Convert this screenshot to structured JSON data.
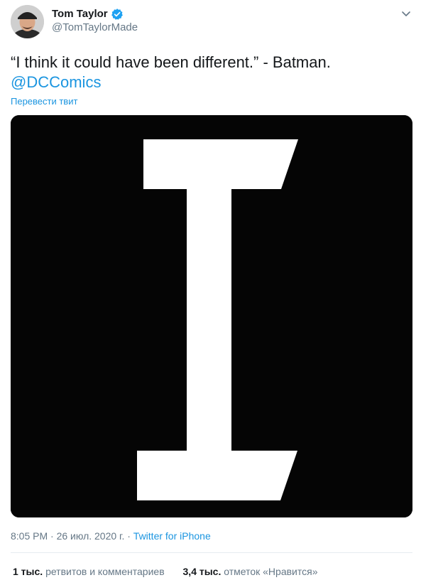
{
  "author": {
    "name": "Tom Taylor",
    "handle": "@TomTaylorMade",
    "verified": true
  },
  "tweet": {
    "text": "“I think it could have been different.” - Batman.",
    "mention": "@DCComics",
    "translate_label": "Перевести твит"
  },
  "meta": {
    "time": "8:05 PM",
    "separator": "·",
    "date": "26 июл. 2020 г.",
    "source": "Twitter for iPhone"
  },
  "stats": {
    "retweets_count": "1 тыс.",
    "retweets_label": "ретвитов и комментариев",
    "likes_count": "3,4 тыс.",
    "likes_label": "отметок «Нравится»"
  },
  "colors": {
    "link": "#1b95e0",
    "secondary_text": "#657786",
    "primary_text": "#14171a",
    "media_background": "#050505",
    "media_letter": "#ffffff"
  },
  "icons": {
    "verified": "verified-badge-icon",
    "menu": "chevron-down-icon"
  }
}
